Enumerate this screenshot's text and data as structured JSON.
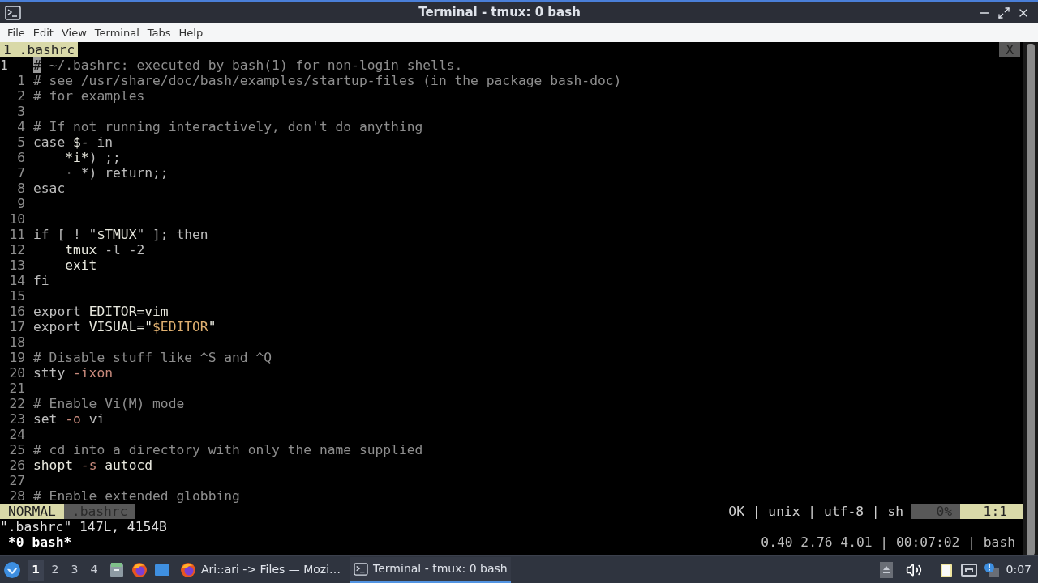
{
  "window": {
    "title": "Terminal - tmux: 0 bash"
  },
  "menu": [
    "File",
    "Edit",
    "View",
    "Terminal",
    "Tabs",
    "Help"
  ],
  "editor": {
    "tabs": [
      {
        "label": "1 .bashrc",
        "selected": true
      }
    ],
    "close": "X",
    "lines": [
      {
        "number": "1",
        "current": true,
        "segments": [
          {
            "text": "#",
            "kind": "cursor"
          },
          {
            "text": " ~/.bashrc: executed by bash(1) for non-login shells.",
            "kind": "comment"
          }
        ]
      },
      {
        "number": "1",
        "current": false,
        "segments": [
          {
            "text": "# see /usr/share/doc/bash/examples/startup-files (in the package bash-doc)",
            "kind": "comment"
          }
        ]
      },
      {
        "number": "2",
        "current": false,
        "segments": [
          {
            "text": "# for examples",
            "kind": "comment"
          }
        ]
      },
      {
        "number": "3",
        "current": false
      },
      {
        "number": "4",
        "current": false,
        "segments": [
          {
            "text": "# If not running interactively, don't do anything",
            "kind": "comment"
          }
        ]
      },
      {
        "number": "5",
        "current": false,
        "segments": [
          {
            "text": "case ",
            "kind": "plain"
          },
          {
            "text": "$-",
            "kind": "bright"
          },
          {
            "text": " in",
            "kind": "plain"
          }
        ]
      },
      {
        "number": "6",
        "current": false,
        "indented": true,
        "segments": [
          {
            "text": "*i*",
            "kind": "bright"
          },
          {
            "text": ") ;;",
            "kind": "plain"
          }
        ]
      },
      {
        "number": "7",
        "current": false,
        "indented": true,
        "segments": [
          {
            "text": "·",
            "kind": "dim"
          },
          {
            "text": " *) return;;",
            "kind": "plain"
          }
        ]
      },
      {
        "number": "8",
        "current": false,
        "segments": [
          {
            "text": "esac",
            "kind": "plain"
          }
        ]
      },
      {
        "number": "9",
        "current": false
      },
      {
        "number": "10",
        "current": false
      },
      {
        "number": "11",
        "current": false,
        "segments": [
          {
            "text": "if [ ! \"",
            "kind": "plain"
          },
          {
            "text": "$TMUX",
            "kind": "bright"
          },
          {
            "text": "\" ]; then",
            "kind": "plain"
          }
        ]
      },
      {
        "number": "12",
        "current": false,
        "indented": true,
        "segments": [
          {
            "text": "tmux",
            "kind": "bright"
          },
          {
            "text": " -l -2",
            "kind": "plain"
          }
        ]
      },
      {
        "number": "13",
        "current": false,
        "indented": true,
        "segments": [
          {
            "text": "exit",
            "kind": "bright"
          }
        ]
      },
      {
        "number": "14",
        "current": false,
        "segments": [
          {
            "text": "fi",
            "kind": "plain"
          }
        ]
      },
      {
        "number": "15",
        "current": false
      },
      {
        "number": "16",
        "current": false,
        "segments": [
          {
            "text": "export ",
            "kind": "plain"
          },
          {
            "text": "EDITOR=vim",
            "kind": "bright"
          }
        ]
      },
      {
        "number": "17",
        "current": false,
        "segments": [
          {
            "text": "export ",
            "kind": "plain"
          },
          {
            "text": "VISUAL=\"",
            "kind": "bright"
          },
          {
            "text": "$EDITOR",
            "kind": "string"
          },
          {
            "text": "\"",
            "kind": "bright"
          }
        ]
      },
      {
        "number": "18",
        "current": false
      },
      {
        "number": "19",
        "current": false,
        "segments": [
          {
            "text": "# Disable stuff like ^S and ^Q",
            "kind": "comment"
          }
        ]
      },
      {
        "number": "20",
        "current": false,
        "segments": [
          {
            "text": "stty ",
            "kind": "plain"
          },
          {
            "text": "-ixon",
            "kind": "flag"
          }
        ]
      },
      {
        "number": "21",
        "current": false
      },
      {
        "number": "22",
        "current": false,
        "segments": [
          {
            "text": "# Enable Vi(M) mode",
            "kind": "comment"
          }
        ]
      },
      {
        "number": "23",
        "current": false,
        "segments": [
          {
            "text": "set ",
            "kind": "plain"
          },
          {
            "text": "-o",
            "kind": "flag"
          },
          {
            "text": " vi",
            "kind": "plain"
          }
        ]
      },
      {
        "number": "24",
        "current": false
      },
      {
        "number": "25",
        "current": false,
        "segments": [
          {
            "text": "# cd into a directory with only the name supplied",
            "kind": "comment"
          }
        ]
      },
      {
        "number": "26",
        "current": false,
        "segments": [
          {
            "text": "shopt ",
            "kind": "bright"
          },
          {
            "text": "-s",
            "kind": "flag"
          },
          {
            "text": " autocd",
            "kind": "bright"
          }
        ]
      },
      {
        "number": "27",
        "current": false
      },
      {
        "number": "28",
        "current": false,
        "segments": [
          {
            "text": "# Enable extended globbing",
            "kind": "comment"
          }
        ]
      }
    ],
    "statusline": {
      "mode": "NORMAL",
      "file": ".bashrc",
      "info": "OK | unix | utf-8 | sh",
      "percent": "0%",
      "position": "1:1"
    },
    "message": "\".bashrc\" 147L, 4154B"
  },
  "tmux": {
    "window": "*0 bash*",
    "status": "0.40 2.76 4.01 | 00:07:02 | bash"
  },
  "taskbar": {
    "workspaces": [
      {
        "label": "1",
        "selected": true
      },
      {
        "label": "2",
        "selected": false
      },
      {
        "label": "3",
        "selected": false
      },
      {
        "label": "4",
        "selected": false
      }
    ],
    "tasks": [
      {
        "label": "Ari::ari -> Files — Mozi…",
        "kind": "browser",
        "selected": false
      },
      {
        "label": "Terminal - tmux: 0 bash",
        "kind": "terminal",
        "selected": true
      }
    ],
    "clock": "0:07"
  }
}
